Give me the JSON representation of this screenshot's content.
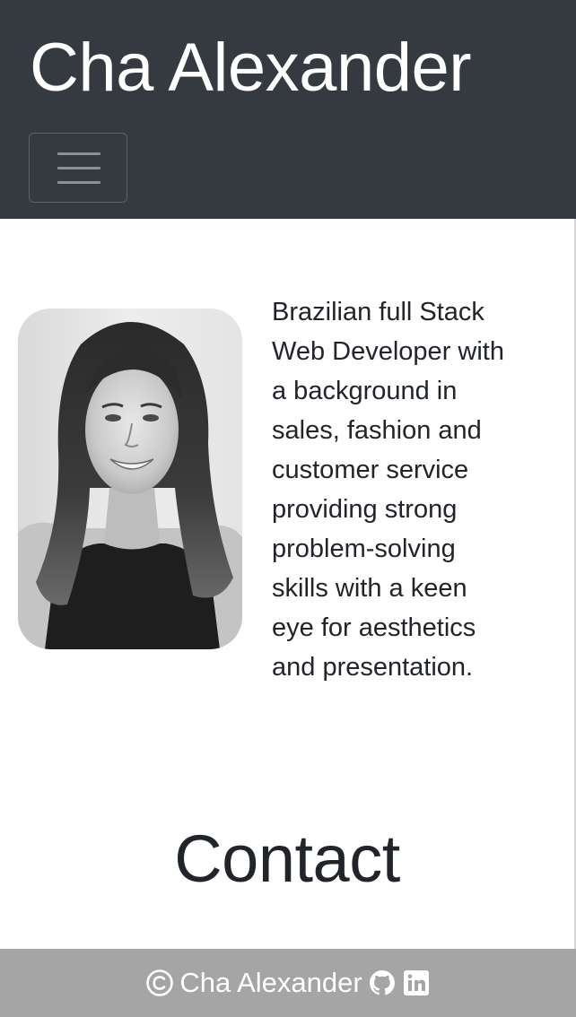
{
  "navbar": {
    "brand": "Cha Alexander",
    "toggler_icon": "hamburger-menu-icon"
  },
  "about": {
    "photo_icon": "profile-photo",
    "bio": "Brazilian full Stack Web Developer with a background in sales, fashion and customer service providing strong problem-solving skills with a keen eye for aesthetics and presentation."
  },
  "contact": {
    "heading": "Contact"
  },
  "footer": {
    "copyright_icon": "copyright-icon",
    "name": "Cha Alexander",
    "links": [
      {
        "icon": "github-icon"
      },
      {
        "icon": "linkedin-icon"
      }
    ]
  },
  "colors": {
    "navbar_bg": "#343a40",
    "footer_bg": "#a5a5a5",
    "text": "#212529",
    "brand_text": "#ffffff"
  }
}
